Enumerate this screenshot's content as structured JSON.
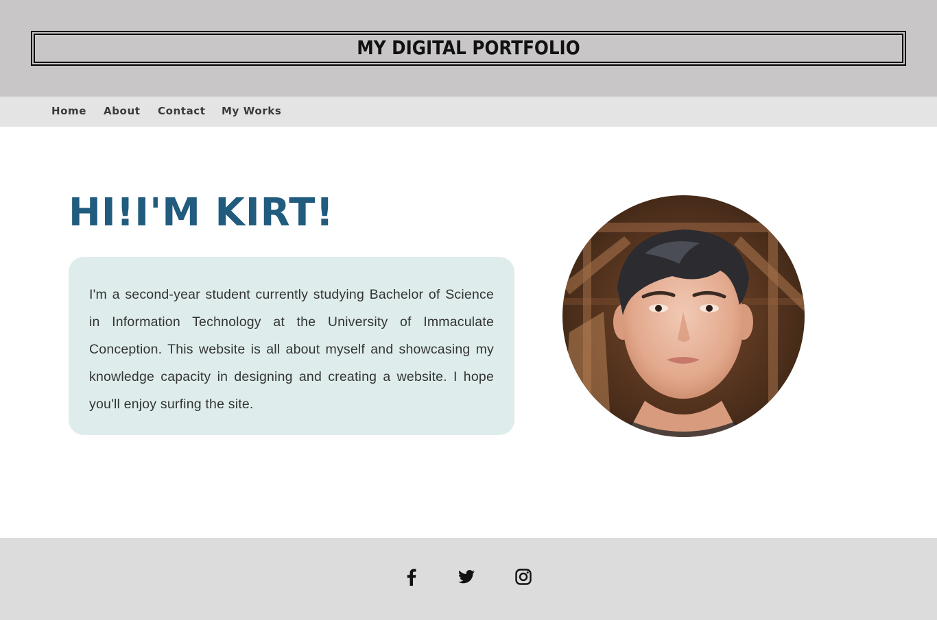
{
  "header": {
    "title": "MY DIGITAL PORTFOLIO"
  },
  "nav": {
    "items": [
      {
        "label": "Home"
      },
      {
        "label": "About"
      },
      {
        "label": "Contact"
      },
      {
        "label": "My Works"
      }
    ]
  },
  "hero": {
    "heading": "HI!I'M KIRT!",
    "intro": "I'm a second-year student currently studying Bachelor of Science in Information Technology at the University of Immaculate Conception. This website is all about myself and showcasing my knowledge capacity in designing and creating a website. I hope you'll enjoy surfing the site."
  },
  "profile_photo": {
    "icon": "profile-photo"
  },
  "footer": {
    "social": [
      {
        "icon": "facebook-icon"
      },
      {
        "icon": "twitter-icon"
      },
      {
        "icon": "instagram-icon"
      }
    ]
  },
  "colors": {
    "header_bg": "#c8c6c7",
    "nav_bg": "#e4e4e4",
    "heading": "#215b7d",
    "card_bg": "#deedeb",
    "footer_bg": "#dcdcdc"
  }
}
